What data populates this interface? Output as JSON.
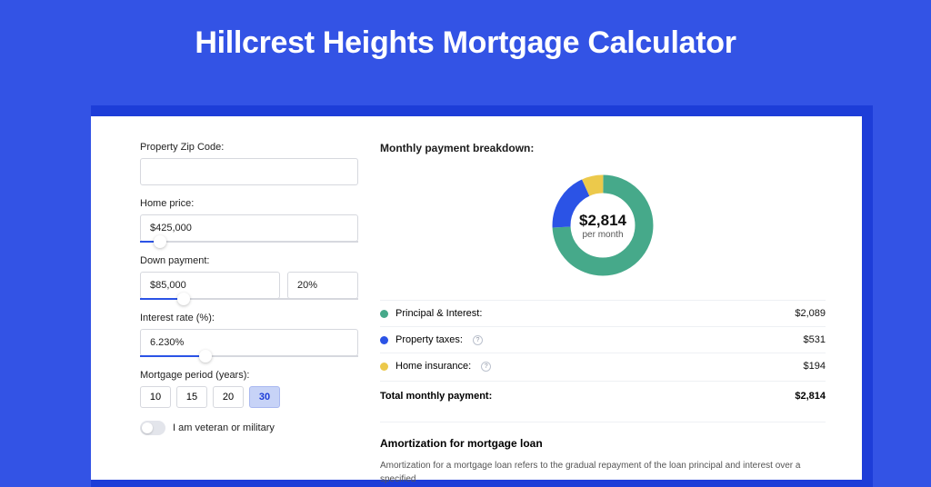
{
  "title": "Hillcrest Heights Mortgage Calculator",
  "form": {
    "zip": {
      "label": "Property Zip Code:",
      "value": ""
    },
    "home_price": {
      "label": "Home price:",
      "value": "$425,000",
      "slider_pct": 9
    },
    "down_payment": {
      "label": "Down payment:",
      "value": "$85,000",
      "pct_value": "20%",
      "slider_pct": 20
    },
    "interest_rate": {
      "label": "Interest rate (%):",
      "value": "6.230%",
      "slider_pct": 30
    },
    "period": {
      "label": "Mortgage period (years):",
      "options": [
        "10",
        "15",
        "20",
        "30"
      ],
      "selected": "30"
    },
    "veteran": {
      "label": "I am veteran or military",
      "checked": false
    }
  },
  "breakdown": {
    "title": "Monthly payment breakdown:",
    "center_amount": "$2,814",
    "center_sub": "per month",
    "items": [
      {
        "label": "Principal & Interest:",
        "value": "$2,089",
        "color": "green",
        "info": false
      },
      {
        "label": "Property taxes:",
        "value": "$531",
        "color": "blue",
        "info": true
      },
      {
        "label": "Home insurance:",
        "value": "$194",
        "color": "yellow",
        "info": true
      }
    ],
    "total_label": "Total monthly payment:",
    "total_value": "$2,814"
  },
  "amortization": {
    "title": "Amortization for mortgage loan",
    "body": "Amortization for a mortgage loan refers to the gradual repayment of the loan principal and interest over a specified"
  },
  "chart_data": {
    "type": "pie",
    "title": "Monthly payment breakdown",
    "series": [
      {
        "name": "Principal & Interest",
        "value": 2089,
        "color": "#46a98a"
      },
      {
        "name": "Property taxes",
        "value": 531,
        "color": "#2b53e6"
      },
      {
        "name": "Home insurance",
        "value": 194,
        "color": "#ecc94b"
      }
    ],
    "total": 2814,
    "unit": "$ per month"
  }
}
